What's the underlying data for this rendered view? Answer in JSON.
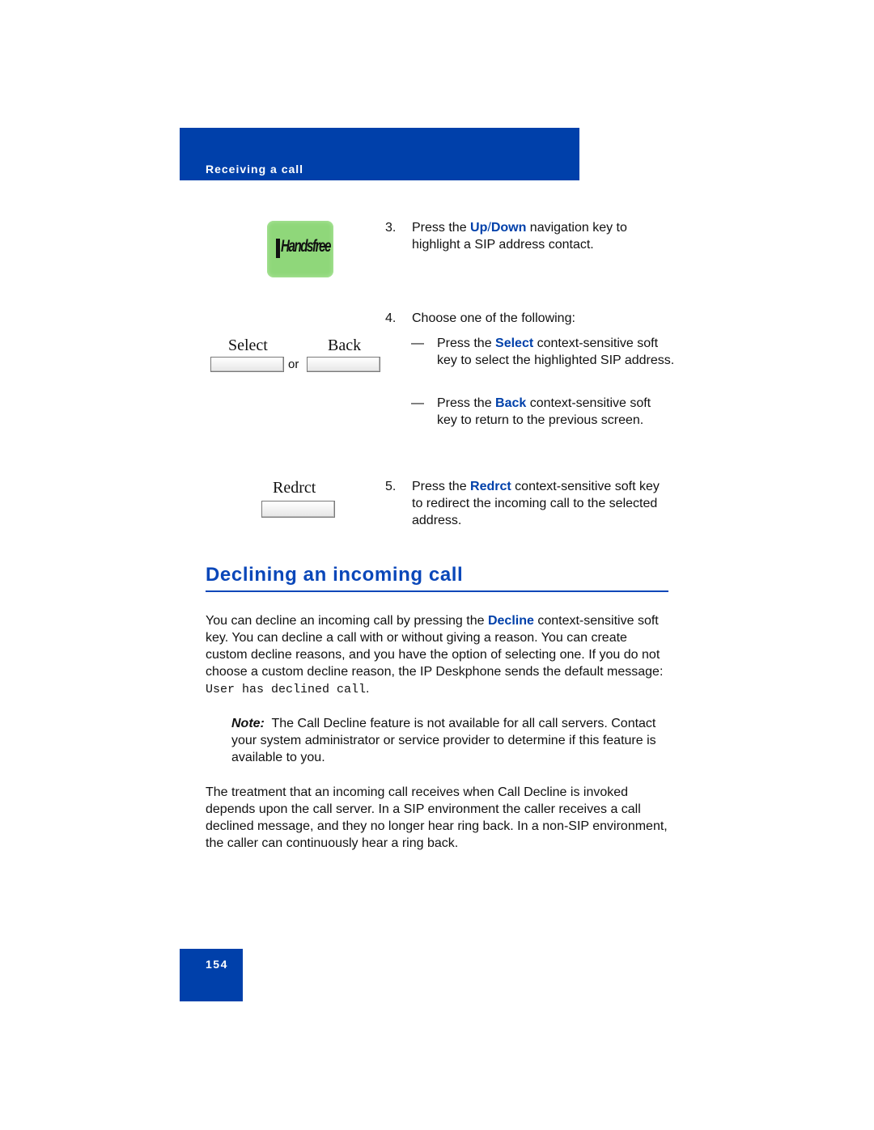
{
  "header": {
    "section_title": "Receiving a call"
  },
  "keys": {
    "handsfree_label": "Handsfree",
    "select_label": "Select",
    "back_label": "Back",
    "or_text": "or",
    "redrct_label": "Redrct"
  },
  "steps": [
    {
      "num": "3.",
      "pre": "Press the ",
      "kw1": "Up",
      "sep": "/",
      "kw2": "Down",
      "post": " navigation key to highlight a SIP address contact."
    },
    {
      "num": "4.",
      "text": "Choose one of the following:"
    },
    {
      "num": "5.",
      "pre": "Press the ",
      "kw": "Redrct",
      "post": " context-sensitive soft key to redirect the incoming call to the selected address."
    }
  ],
  "substeps": [
    {
      "dash": "—",
      "pre": "Press the ",
      "kw": "Select",
      "post": " context-sensitive soft key to select the highlighted SIP address."
    },
    {
      "dash": "—",
      "pre": "Press the ",
      "kw": "Back",
      "post": " context-sensitive soft key to return to the previous screen."
    }
  ],
  "section": {
    "heading": "Declining an incoming call",
    "intro_pre": "You can decline an incoming call by pressing the ",
    "intro_kw": "Decline",
    "intro_post": " context-sensitive soft key. You can decline a call with or without giving a reason. You can create custom decline reasons, and you have the option of selecting one. If you do not choose a custom decline reason, the IP Deskphone sends the default message: ",
    "default_message": "User has declined call",
    "intro_end": ".",
    "note_label": "Note:",
    "note_text": "  The Call Decline feature is not available for all call servers. Contact your system administrator or service provider to determine if this feature is available to you.",
    "treatment": "The treatment that an incoming call receives when Call Decline is invoked depends upon the call server. In a SIP environment the caller receives a call declined message, and they no longer hear ring back. In a non-SIP environment, the caller can continuously hear a ring back."
  },
  "footer": {
    "page_number": "154"
  },
  "colors": {
    "brand_blue": "#0040aa",
    "key_green": "#8fd77a"
  }
}
